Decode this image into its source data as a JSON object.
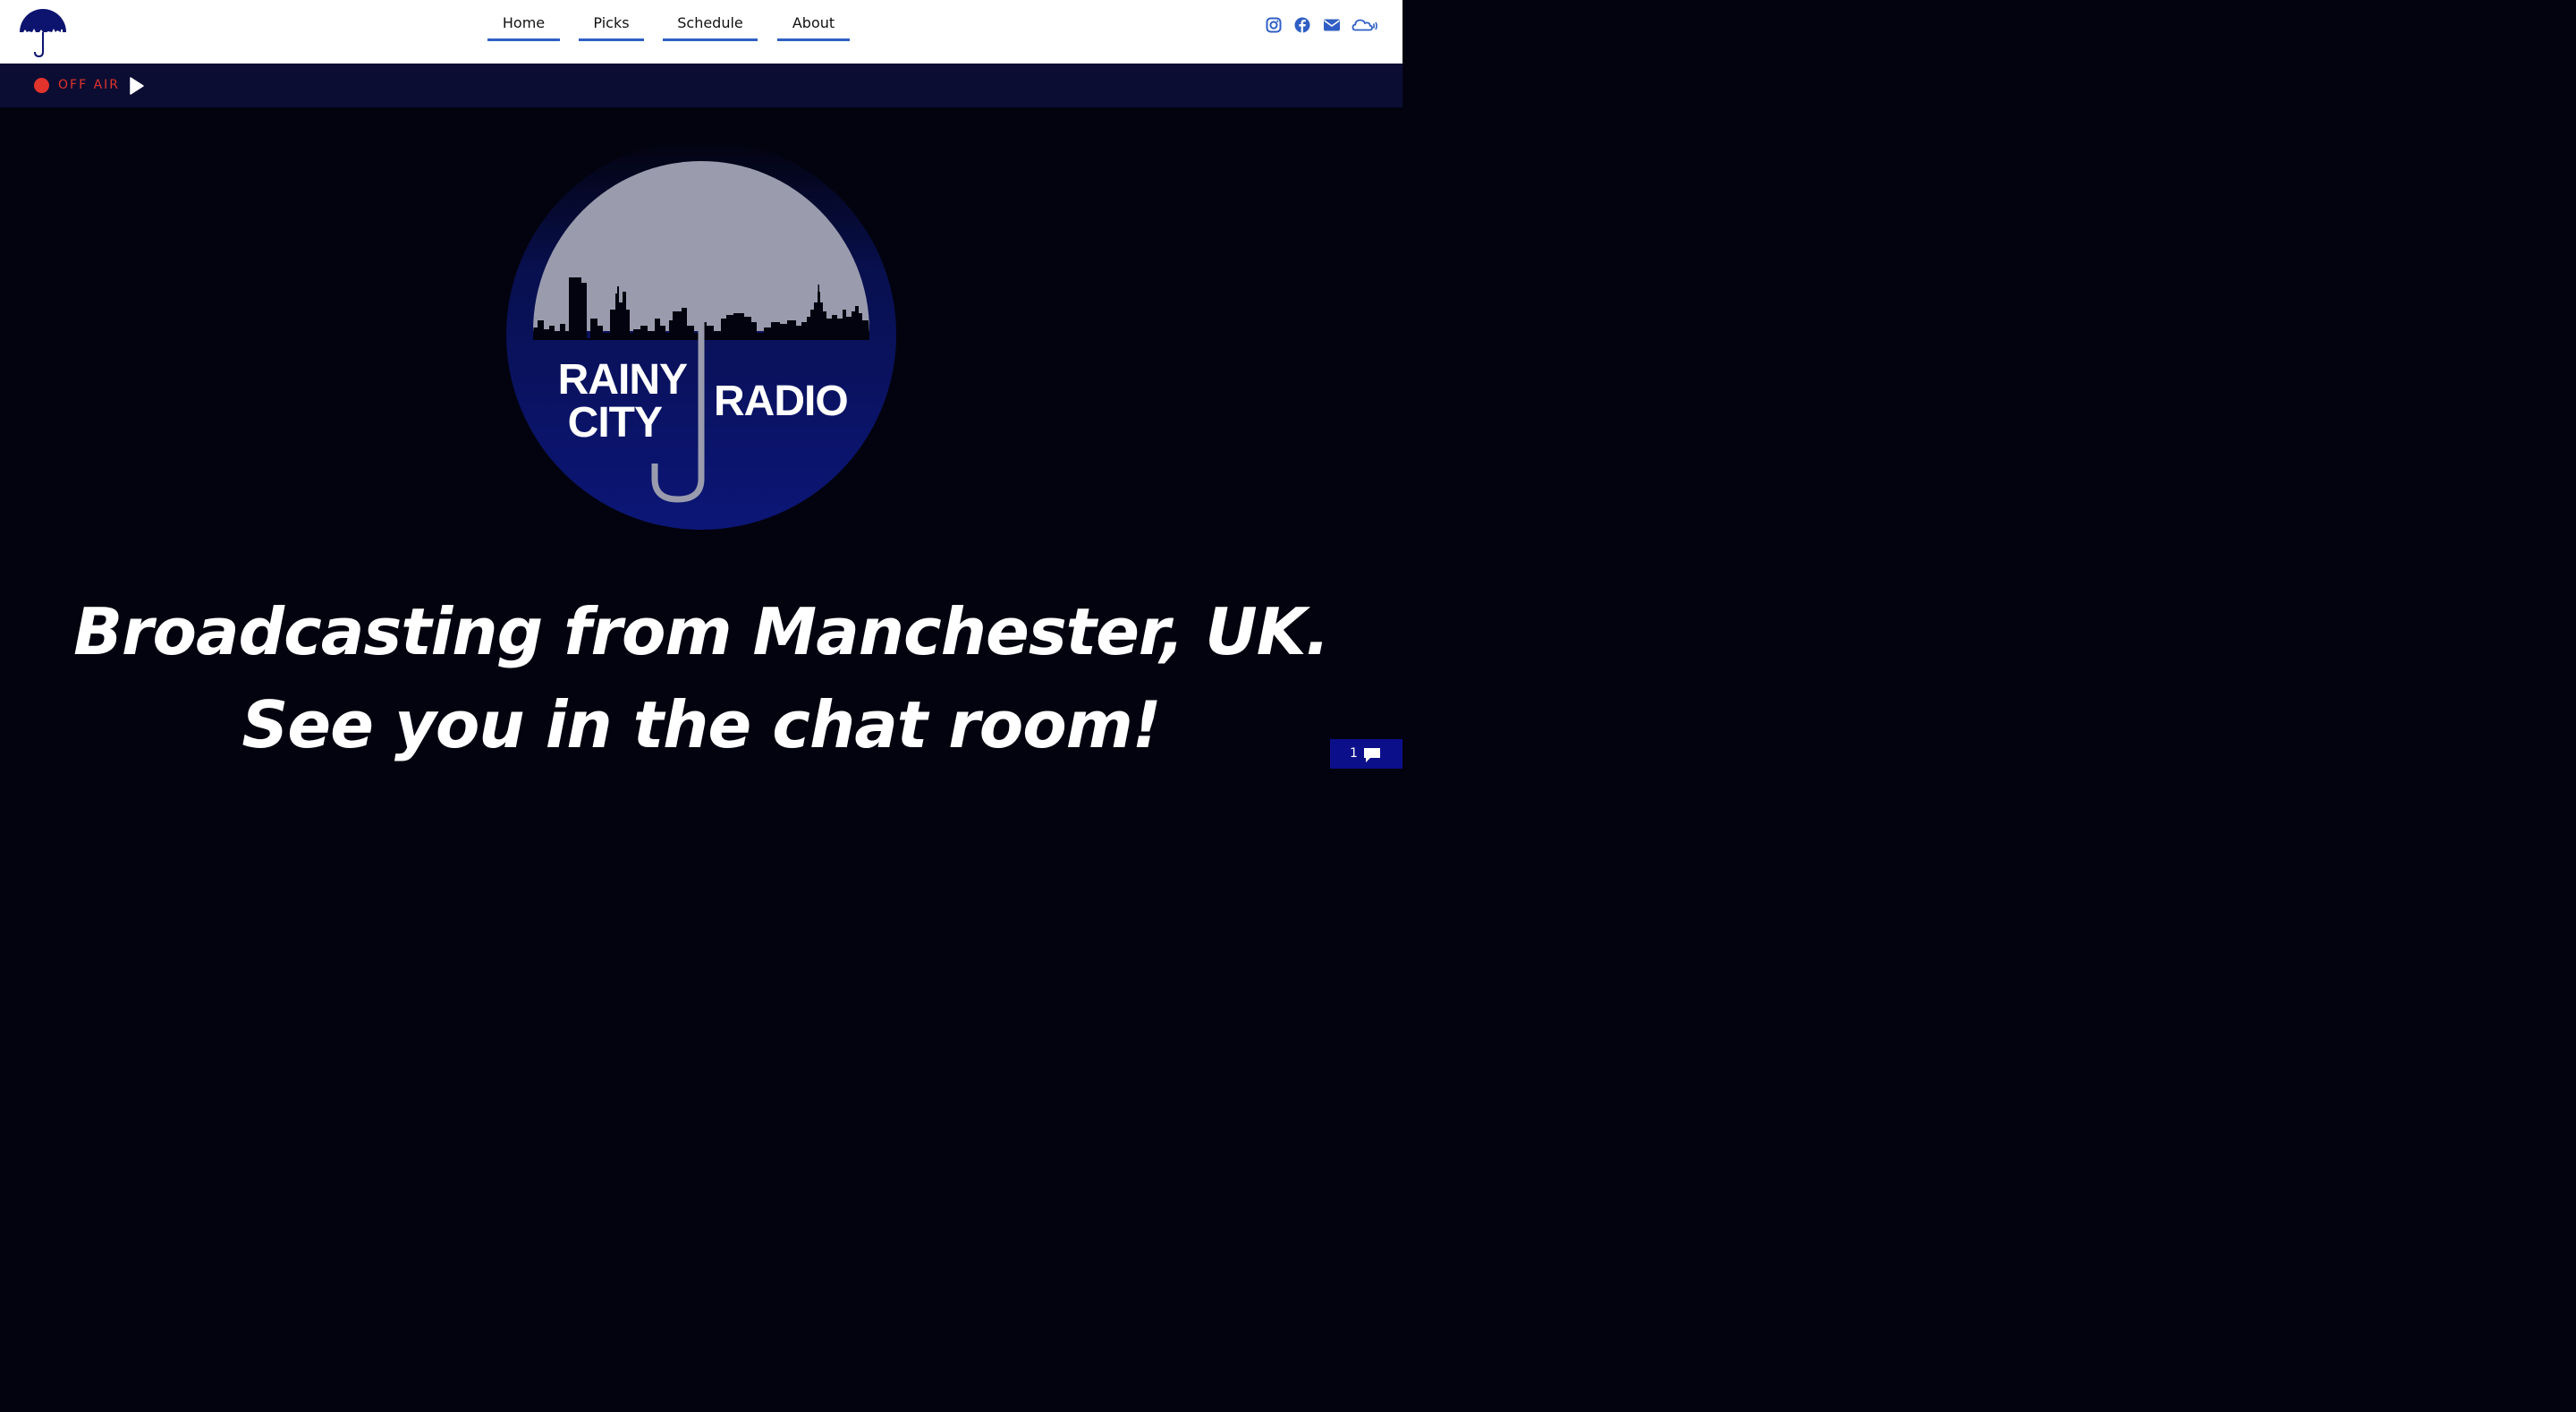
{
  "header": {
    "nav": [
      {
        "label": "Home"
      },
      {
        "label": "Picks"
      },
      {
        "label": "Schedule"
      },
      {
        "label": "About"
      }
    ],
    "social_icons": [
      "instagram-icon",
      "facebook-icon",
      "email-icon",
      "soundcloud-icon"
    ]
  },
  "status": {
    "label": "OFF AIR"
  },
  "hero": {
    "logo_word_1": "RAINY",
    "logo_word_2": "CITY",
    "logo_word_3": "RADIO",
    "line1": "Broadcasting from Manchester, UK.",
    "line2": "See you in the chat room!"
  },
  "chat": {
    "count": "1"
  },
  "colors": {
    "accent": "#2f5fc4",
    "status_red": "#e2332c",
    "bar_bg": "#0b0d33",
    "page_bg": "#03030f",
    "logo_blue": "#0c1470",
    "umbrella_grey": "#9a9cae"
  }
}
